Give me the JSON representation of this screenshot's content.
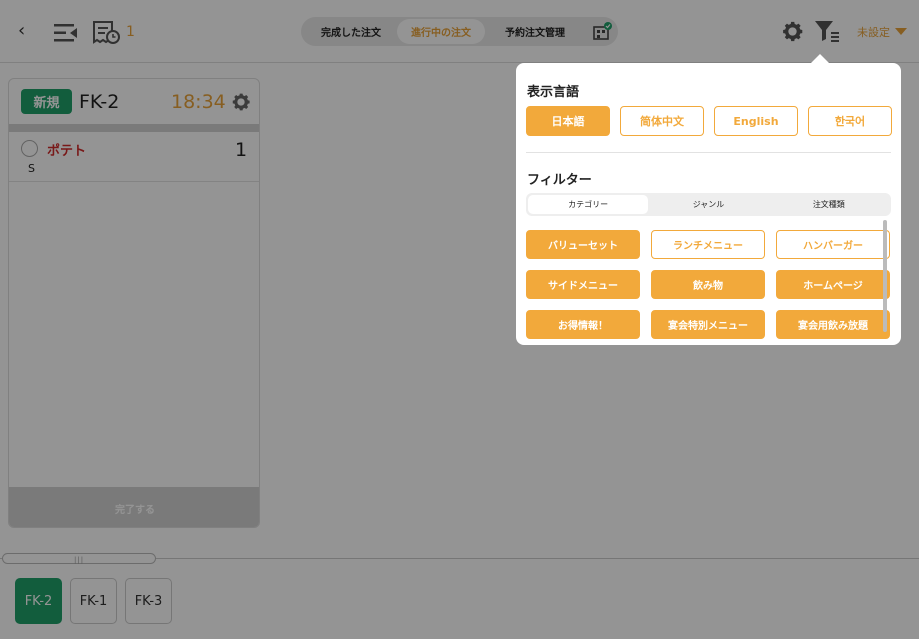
{
  "header": {
    "receipt_count": "1",
    "segments": [
      "完成した注文",
      "進行中の注文",
      "予約注文管理"
    ],
    "active_segment": "進行中の注文",
    "unset_label": "未設定"
  },
  "order_card": {
    "badge": "新規",
    "title": "FK-2",
    "time": "18:34",
    "item": {
      "name": "ポテト",
      "qty": "1",
      "size": "S"
    },
    "complete_label": "完了する"
  },
  "bottom_tabs": [
    "FK-2",
    "FK-1",
    "FK-3"
  ],
  "popover": {
    "language_title": "表示言語",
    "languages": [
      "日本語",
      "简体中文",
      "English",
      "한국어"
    ],
    "filter_title": "フィルター",
    "filter_tabs": [
      "カテゴリー",
      "ジャンル",
      "注文種類"
    ],
    "categories": [
      "バリューセット",
      "ランチメニュー",
      "ハンバーガー",
      "サイドメニュー",
      "飲み物",
      "ホームページ",
      "お得情報！",
      "宴会特別メニュー",
      "宴会用飲み放題"
    ]
  },
  "colors": {
    "accent": "#f2a93b",
    "green": "#1fa06a",
    "red": "#d12b2b"
  }
}
